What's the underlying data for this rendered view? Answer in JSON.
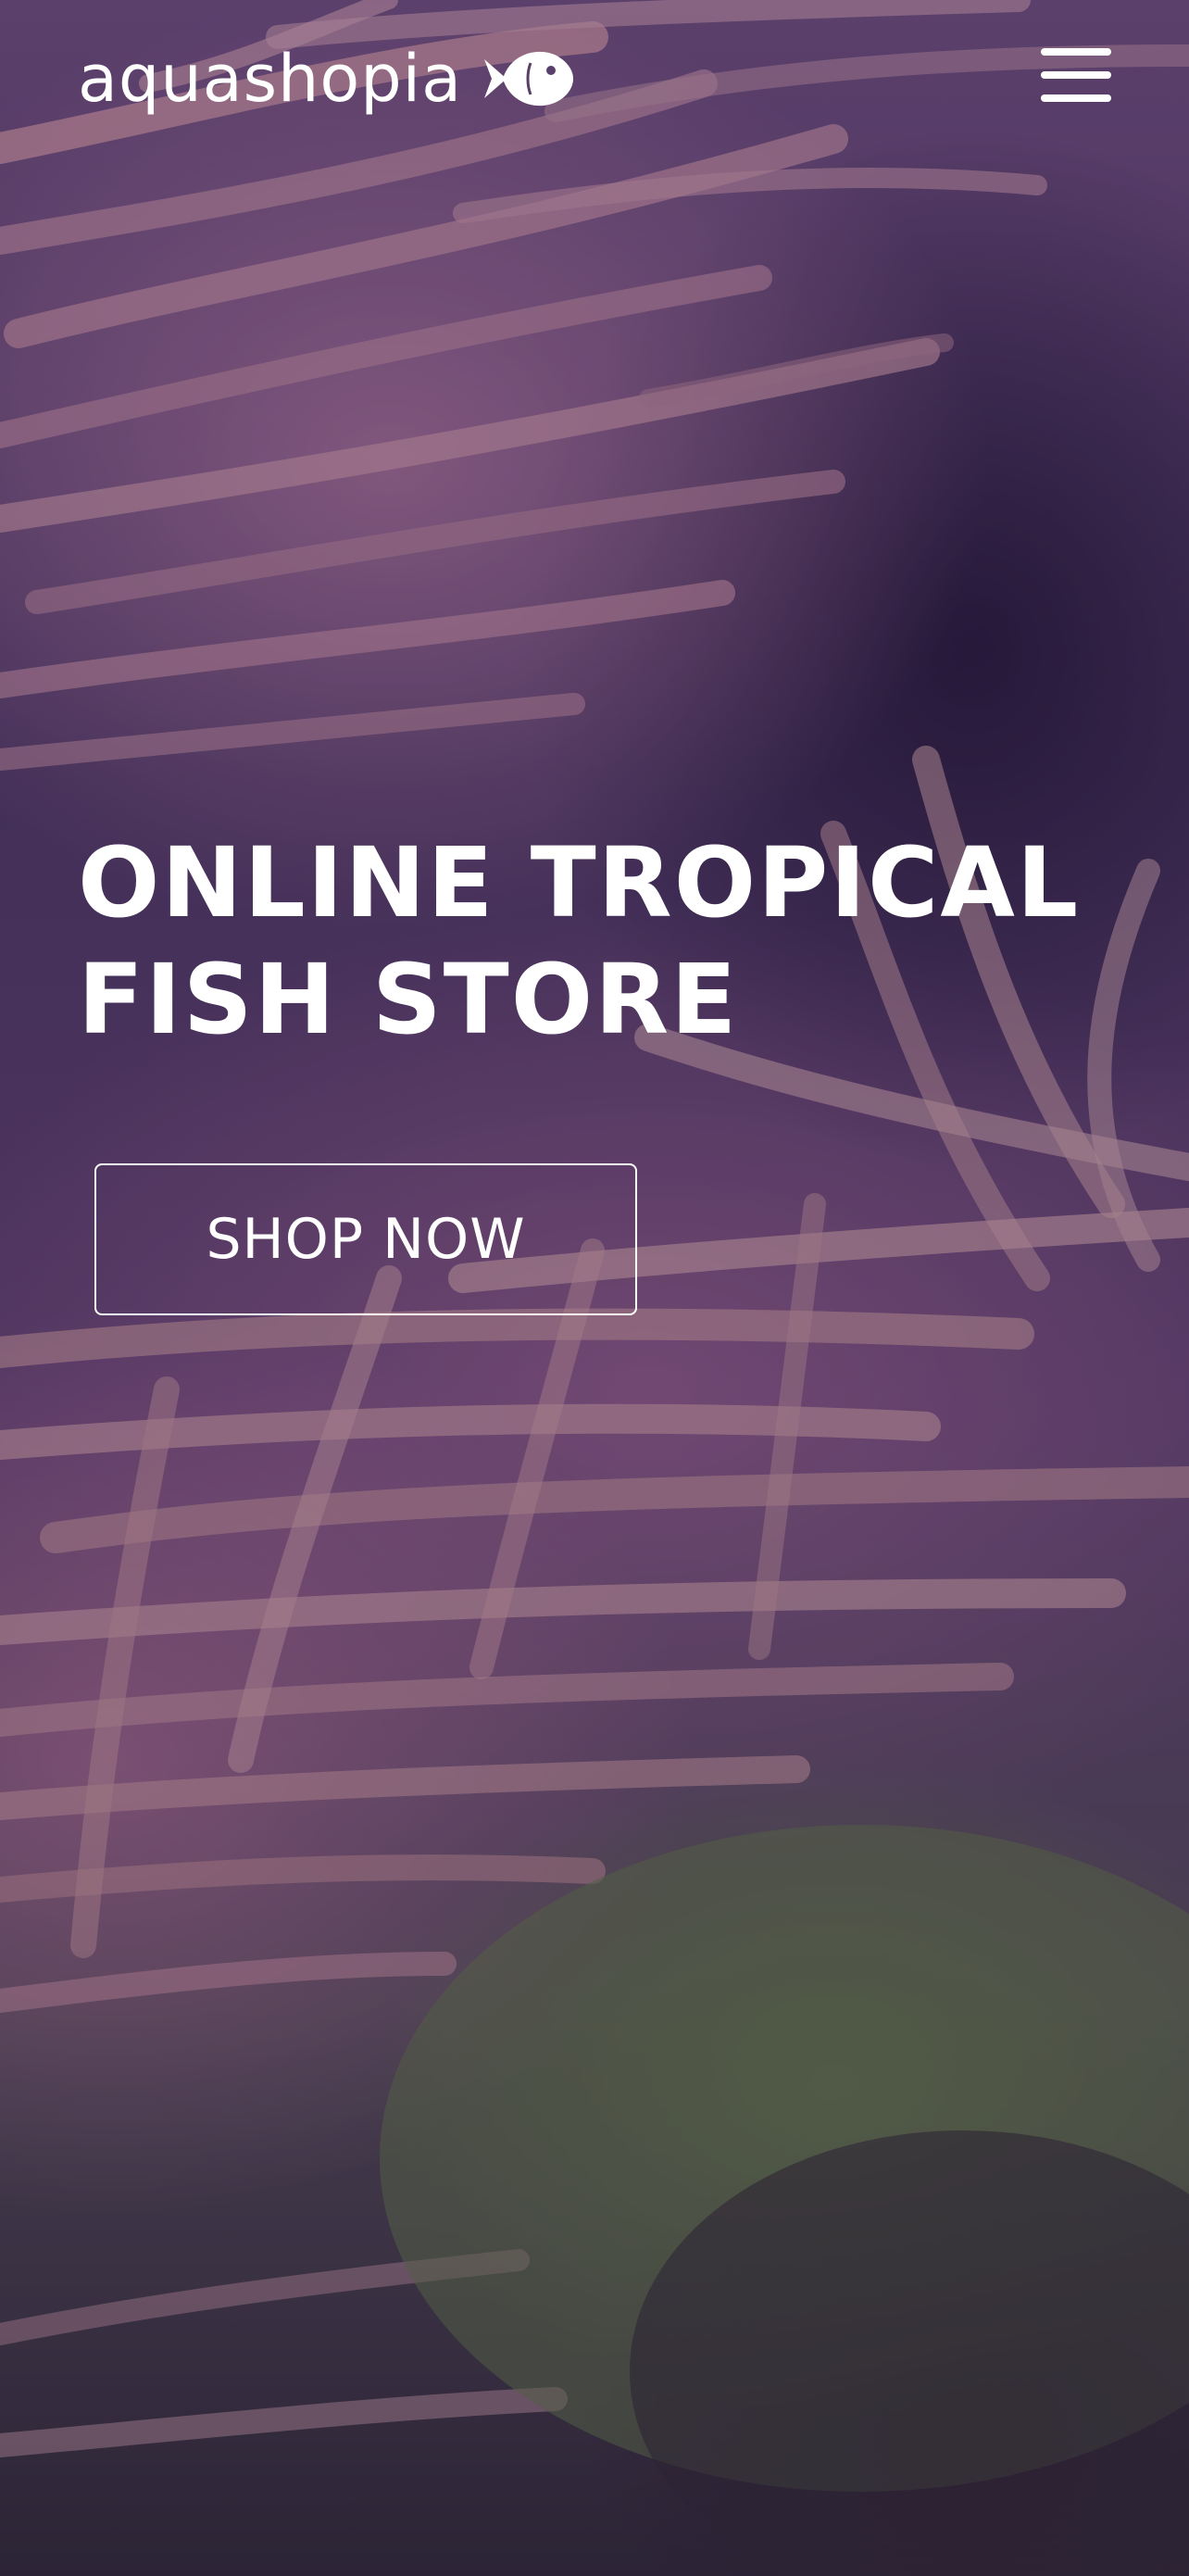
{
  "header": {
    "logo_text": "aquashopia",
    "logo_icon": "fish-icon",
    "menu_icon": "hamburger-menu-icon"
  },
  "hero": {
    "title": "ONLINE TROPICAL FISH STORE",
    "cta_label": "SHOP NOW",
    "background": "coral-anemone-reef-photo"
  },
  "colors": {
    "text": "#ffffff",
    "overlay": "#5a3f6b",
    "rock": "#60784a"
  }
}
